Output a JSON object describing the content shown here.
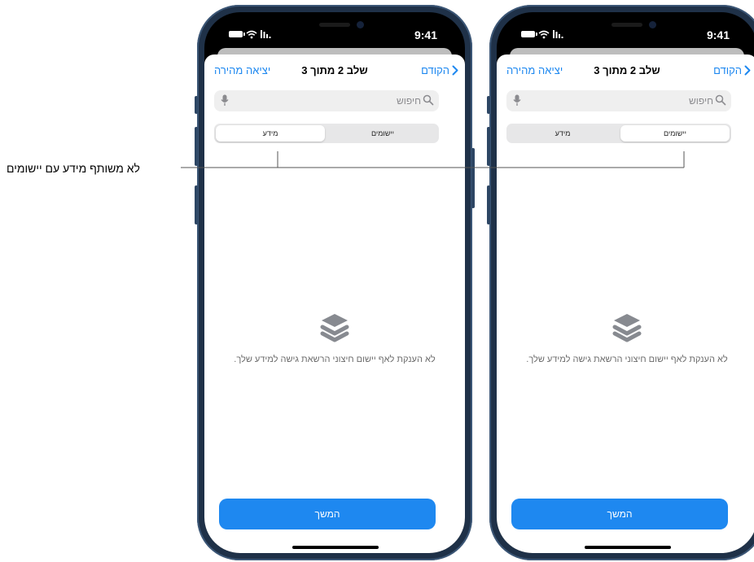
{
  "callout": {
    "text": "לא משותף מידע עם יישומים"
  },
  "colors": {
    "accent": "#1e88f0",
    "device_frame": "#1f3148"
  },
  "phones": [
    {
      "status": {
        "time": "9:41"
      },
      "nav": {
        "back_label": "הקודם",
        "title": "שלב 2 מתוך 3",
        "exit_label": "יציאה מהירה"
      },
      "search": {
        "placeholder": "חיפוש"
      },
      "segments": {
        "left_label": "מידע",
        "right_label": "יישומים",
        "selected": "מידע"
      },
      "empty_state": {
        "icon": "layers-stack-icon",
        "text": "לא הענקת לאף יישום חיצוני הרשאת גישה למידע שלך."
      },
      "continue_label": "המשך"
    },
    {
      "status": {
        "time": "9:41"
      },
      "nav": {
        "back_label": "הקודם",
        "title": "שלב 2 מתוך 3",
        "exit_label": "יציאה מהירה"
      },
      "search": {
        "placeholder": "חיפוש"
      },
      "segments": {
        "left_label": "מידע",
        "right_label": "יישומים",
        "selected": "יישומים"
      },
      "empty_state": {
        "icon": "layers-stack-icon",
        "text": "לא הענקת לאף יישום חיצוני הרשאת גישה למידע שלך."
      },
      "continue_label": "המשך"
    }
  ]
}
